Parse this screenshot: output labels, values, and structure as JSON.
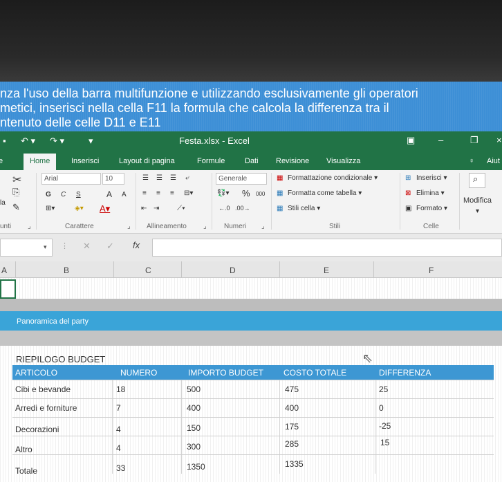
{
  "instruction": {
    "line1": "nza l'uso della barra multifunzione e utilizzando esclusivamente gli operatori",
    "line2": "metici, inserisci nella cella F11 la formula che calcola la differenza tra il",
    "line3": "ntenuto delle celle D11 e E11"
  },
  "window": {
    "title": "Festa.xlsx - Excel"
  },
  "tabs": [
    "Home",
    "Inserisci",
    "Layout di pagina",
    "Formule",
    "Dati",
    "Revisione",
    "Visualizza"
  ],
  "tell_me": "Aiut",
  "ribbon": {
    "font_name": "Arial",
    "font_size": "10",
    "number_format": "Generale",
    "percent": "%",
    "thousands": "000",
    "bold": "G",
    "italic": "C",
    "underline": "S",
    "grow": "A",
    "shrink": "A",
    "paste_label": "la",
    "styles": {
      "conditional": "Formattazione condizionale",
      "as_table": "Formatta come tabella",
      "cell_styles": "Stili cella"
    },
    "cells": {
      "insert": "Inserisci",
      "delete": "Elimina",
      "format": "Formato"
    },
    "modify": "Modifica",
    "groups": {
      "clipboard": "unti",
      "font": "Carattere",
      "alignment": "Allineamento",
      "number": "Numeri",
      "styles": "Stili",
      "cells": "Celle"
    }
  },
  "columns": [
    "A",
    "B",
    "C",
    "D",
    "E",
    "F"
  ],
  "sheet": {
    "banner": "Panoramica del party",
    "budget_title": "RIEPILOGO BUDGET",
    "headers": [
      "ARTICOLO",
      "NUMERO",
      "IMPORTO BUDGET",
      "COSTO TOTALE",
      "DIFFERENZA"
    ],
    "rows": [
      [
        "Cibi e bevande",
        "18",
        "500",
        "475",
        "25"
      ],
      [
        "Arredi e forniture",
        "7",
        "400",
        "400",
        "0"
      ],
      [
        "Decorazioni",
        "4",
        "150",
        "175",
        "-25"
      ],
      [
        "Altro",
        "4",
        "300",
        "285",
        "15"
      ],
      [
        "Totale",
        "33",
        "1350",
        "1335",
        ""
      ]
    ]
  },
  "colors": {
    "excel_green": "#217346",
    "banner_blue": "#3d8fd6",
    "table_header_blue": "#3d97d3"
  }
}
